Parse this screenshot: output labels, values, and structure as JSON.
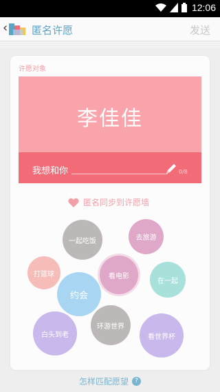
{
  "status_bar": {
    "time": "12:06"
  },
  "header": {
    "title": "匿名许愿",
    "send_label": "发送",
    "back_glyph": "‹"
  },
  "card": {
    "label": "许愿对象",
    "target_name": "李佳佳",
    "wish_prefix": "我想和你",
    "counter": "0/8",
    "sync_label": "匿名同步到许愿墙"
  },
  "bubbles": [
    {
      "label": "一起吃饭",
      "color": "#bdb8b8"
    },
    {
      "label": "去旅游",
      "color": "#e0a8c8"
    },
    {
      "label": "打篮球",
      "color": "#f6bcb8"
    },
    {
      "label": "看电影",
      "color": "#e0a8c8"
    },
    {
      "label": "在一起",
      "color": "#a8e0da"
    },
    {
      "label": "约会",
      "color": "#a8d6f2"
    },
    {
      "label": "环游世界",
      "color": "#bdb8b8"
    },
    {
      "label": "白头到老",
      "color": "#c8b8ec"
    },
    {
      "label": "看世界杯",
      "color": "#c8b8ec"
    }
  ],
  "footer": {
    "link_text": "怎样匹配愿望",
    "help_glyph": "?"
  },
  "colors": {
    "accent_blue": "#5aa4c6",
    "pink": "#f9a3ab",
    "deep_pink": "#f26c78"
  }
}
